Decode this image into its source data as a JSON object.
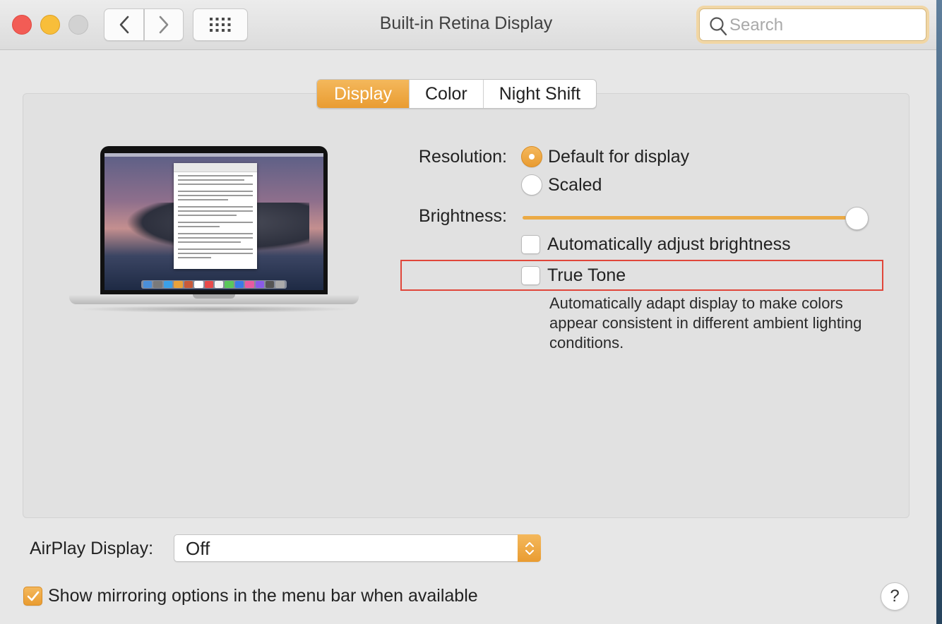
{
  "window": {
    "title": "Built-in Retina Display",
    "search_placeholder": "Search"
  },
  "tabs": [
    {
      "label": "Display",
      "active": true
    },
    {
      "label": "Color",
      "active": false
    },
    {
      "label": "Night Shift",
      "active": false
    }
  ],
  "display": {
    "resolution_label": "Resolution:",
    "resolution_options": [
      {
        "label": "Default for display",
        "selected": true
      },
      {
        "label": "Scaled",
        "selected": false
      }
    ],
    "brightness_label": "Brightness:",
    "brightness_level": 1.0,
    "auto_brightness_label": "Automatically adjust brightness",
    "auto_brightness_checked": false,
    "true_tone_label": "True Tone",
    "true_tone_checked": false,
    "true_tone_description": "Automatically adapt display to make colors appear consistent in different ambient lighting conditions."
  },
  "airplay": {
    "label": "AirPlay Display:",
    "value": "Off"
  },
  "mirroring": {
    "label": "Show mirroring options in the menu bar when available",
    "checked": true
  },
  "help_label": "?",
  "colors": {
    "accent": "#eba64a",
    "highlight_border": "#e0463a"
  }
}
